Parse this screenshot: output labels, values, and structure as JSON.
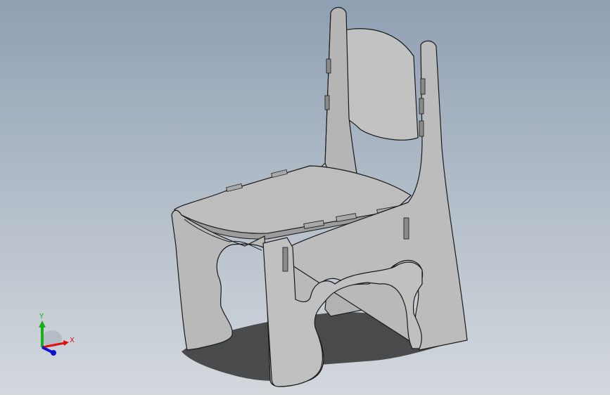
{
  "viewport": {
    "background_top": "#8fa0b3",
    "background_bottom": "#d3d8dd",
    "part_fill": "#b8b8b8",
    "part_fill_light": "#c6c6c6",
    "part_edge": "#1a1a1a",
    "shadow": "#333333"
  },
  "triad": {
    "x_label": "X",
    "y_label": "Y",
    "x_color": "#e01010",
    "y_color": "#18b018",
    "z_color": "#1010d0"
  }
}
